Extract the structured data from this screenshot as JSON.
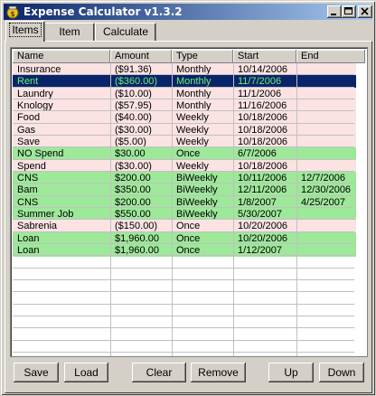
{
  "window": {
    "title": "Expense Calculator v1.3.2",
    "accent_active": "#0a246a",
    "accent_inactive": "#a6caf0"
  },
  "tabs": [
    {
      "label": "Items",
      "active": true
    },
    {
      "label": "Item",
      "active": false
    },
    {
      "label": "Calculate",
      "active": false
    }
  ],
  "columns": [
    "Name",
    "Amount",
    "Type",
    "Start",
    "End"
  ],
  "row_colors": {
    "pink": "#fbe3e3",
    "green": "#9ee89a",
    "selected": "#0a246a",
    "selected_text": "#6cf06c"
  },
  "rows": [
    {
      "name": "Insurance",
      "amount": "($91.36)",
      "type": "Monthly",
      "start": "10/14/2006",
      "end": "",
      "color": "pink"
    },
    {
      "name": "Rent",
      "amount": "($360.00)",
      "type": "Monthly",
      "start": "11/7/2006",
      "end": "",
      "color": "selected"
    },
    {
      "name": "Laundry",
      "amount": "($10.00)",
      "type": "Monthly",
      "start": "11/1/2006",
      "end": "",
      "color": "pink"
    },
    {
      "name": "Knology",
      "amount": "($57.95)",
      "type": "Monthly",
      "start": "11/16/2006",
      "end": "",
      "color": "pink"
    },
    {
      "name": "Food",
      "amount": "($40.00)",
      "type": "Weekly",
      "start": "10/18/2006",
      "end": "",
      "color": "pink"
    },
    {
      "name": "Gas",
      "amount": "($30.00)",
      "type": "Weekly",
      "start": "10/18/2006",
      "end": "",
      "color": "pink"
    },
    {
      "name": "Save",
      "amount": "($5.00)",
      "type": "Weekly",
      "start": "10/18/2006",
      "end": "",
      "color": "pink"
    },
    {
      "name": "NO Spend",
      "amount": "$30.00",
      "type": "Once",
      "start": "6/7/2006",
      "end": "",
      "color": "green"
    },
    {
      "name": "Spend",
      "amount": "($30.00)",
      "type": "Weekly",
      "start": "10/18/2006",
      "end": "",
      "color": "pink"
    },
    {
      "name": "CNS",
      "amount": "$200.00",
      "type": "BiWeekly",
      "start": "10/11/2006",
      "end": "12/7/2006",
      "color": "green"
    },
    {
      "name": "Bam",
      "amount": "$350.00",
      "type": "BiWeekly",
      "start": "12/11/2006",
      "end": "12/30/2006",
      "color": "green"
    },
    {
      "name": "CNS",
      "amount": "$200.00",
      "type": "BiWeekly",
      "start": "1/8/2007",
      "end": "4/25/2007",
      "color": "green"
    },
    {
      "name": "Summer Job",
      "amount": "$550.00",
      "type": "BiWeekly",
      "start": "5/30/2007",
      "end": "",
      "color": "green"
    },
    {
      "name": "Sabrenia",
      "amount": "($150.00)",
      "type": "Once",
      "start": "10/20/2006",
      "end": "",
      "color": "pink"
    },
    {
      "name": "Loan",
      "amount": "$1,960.00",
      "type": "Once",
      "start": "10/20/2006",
      "end": "",
      "color": "green"
    },
    {
      "name": "Loan",
      "amount": "$1,960.00",
      "type": "Once",
      "start": "1/12/2007",
      "end": "",
      "color": "green"
    }
  ],
  "buttons": {
    "save": "Save",
    "load": "Load",
    "clear": "Clear",
    "remove": "Remove",
    "up": "Up",
    "down": "Down"
  }
}
